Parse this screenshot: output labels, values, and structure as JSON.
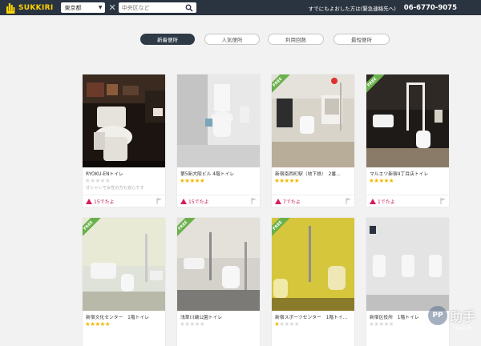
{
  "header": {
    "logo_text": "SUKKIRI",
    "prefecture": "東京都",
    "search_placeholder": "中央区など",
    "emergency_text": "すでにもよおした方は(緊急連絡先へ)",
    "phone": "06-6770-9075",
    "brand_color": "#ffd200"
  },
  "tabs": [
    {
      "label": "新着便所",
      "active": true
    },
    {
      "label": "人気便所",
      "active": false
    },
    {
      "label": "利用回数",
      "active": false
    },
    {
      "label": "最短便所",
      "active": false
    }
  ],
  "cards": [
    {
      "name": "RYOKU-ENトイレ",
      "rating": 0,
      "desc": "オシャレで女性の方も安心です",
      "likes": "15でたよ",
      "free": false
    },
    {
      "name": "第5新大阪ビル 4階トイレ",
      "rating": 5,
      "desc": "",
      "likes": "15でたよ",
      "free": false
    },
    {
      "name": "新宿南西町駅（地下鉄）　2番...",
      "rating": 5,
      "desc": "",
      "likes": "7でたよ",
      "free": true
    },
    {
      "name": "マルエツ新宿4丁目店トイレ",
      "rating": 5,
      "desc": "",
      "likes": "1でたよ",
      "free": true
    },
    {
      "name": "新宿文化センター　1階トイレ",
      "rating": 5,
      "desc": "",
      "likes": "",
      "free": true
    },
    {
      "name": "浅草川端公園トイレ",
      "rating": 0,
      "desc": "",
      "likes": "",
      "free": true
    },
    {
      "name": "新宿スポーツセンター　1階トイ...",
      "rating": 1,
      "desc": "",
      "likes": "",
      "free": true
    },
    {
      "name": "新宿区役所　1階トイレ",
      "rating": 0,
      "desc": "",
      "likes": "",
      "free": false
    }
  ],
  "free_badge": "FREE",
  "watermark": {
    "mark": "PP",
    "text": "助手",
    "sub": "25PP.COM"
  }
}
